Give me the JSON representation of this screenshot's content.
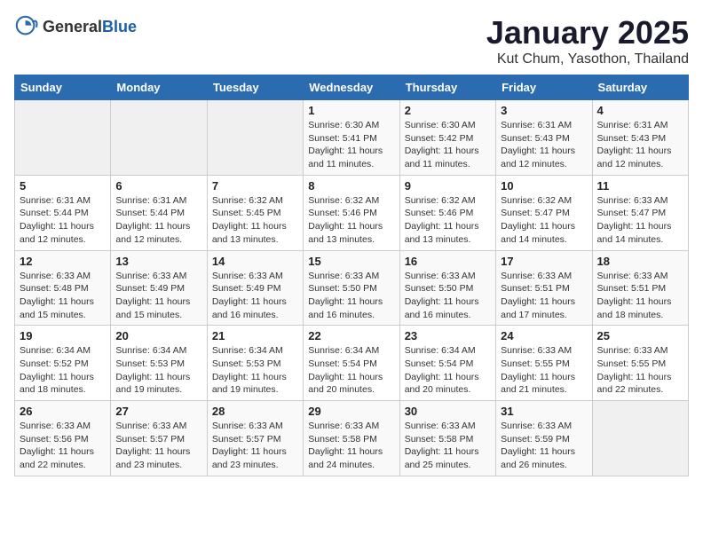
{
  "header": {
    "logo_general": "General",
    "logo_blue": "Blue",
    "title": "January 2025",
    "subtitle": "Kut Chum, Yasothon, Thailand"
  },
  "days_of_week": [
    "Sunday",
    "Monday",
    "Tuesday",
    "Wednesday",
    "Thursday",
    "Friday",
    "Saturday"
  ],
  "weeks": [
    [
      {
        "day": "",
        "info": ""
      },
      {
        "day": "",
        "info": ""
      },
      {
        "day": "",
        "info": ""
      },
      {
        "day": "1",
        "info": "Sunrise: 6:30 AM\nSunset: 5:41 PM\nDaylight: 11 hours\nand 11 minutes."
      },
      {
        "day": "2",
        "info": "Sunrise: 6:30 AM\nSunset: 5:42 PM\nDaylight: 11 hours\nand 11 minutes."
      },
      {
        "day": "3",
        "info": "Sunrise: 6:31 AM\nSunset: 5:43 PM\nDaylight: 11 hours\nand 12 minutes."
      },
      {
        "day": "4",
        "info": "Sunrise: 6:31 AM\nSunset: 5:43 PM\nDaylight: 11 hours\nand 12 minutes."
      }
    ],
    [
      {
        "day": "5",
        "info": "Sunrise: 6:31 AM\nSunset: 5:44 PM\nDaylight: 11 hours\nand 12 minutes."
      },
      {
        "day": "6",
        "info": "Sunrise: 6:31 AM\nSunset: 5:44 PM\nDaylight: 11 hours\nand 12 minutes."
      },
      {
        "day": "7",
        "info": "Sunrise: 6:32 AM\nSunset: 5:45 PM\nDaylight: 11 hours\nand 13 minutes."
      },
      {
        "day": "8",
        "info": "Sunrise: 6:32 AM\nSunset: 5:46 PM\nDaylight: 11 hours\nand 13 minutes."
      },
      {
        "day": "9",
        "info": "Sunrise: 6:32 AM\nSunset: 5:46 PM\nDaylight: 11 hours\nand 13 minutes."
      },
      {
        "day": "10",
        "info": "Sunrise: 6:32 AM\nSunset: 5:47 PM\nDaylight: 11 hours\nand 14 minutes."
      },
      {
        "day": "11",
        "info": "Sunrise: 6:33 AM\nSunset: 5:47 PM\nDaylight: 11 hours\nand 14 minutes."
      }
    ],
    [
      {
        "day": "12",
        "info": "Sunrise: 6:33 AM\nSunset: 5:48 PM\nDaylight: 11 hours\nand 15 minutes."
      },
      {
        "day": "13",
        "info": "Sunrise: 6:33 AM\nSunset: 5:49 PM\nDaylight: 11 hours\nand 15 minutes."
      },
      {
        "day": "14",
        "info": "Sunrise: 6:33 AM\nSunset: 5:49 PM\nDaylight: 11 hours\nand 16 minutes."
      },
      {
        "day": "15",
        "info": "Sunrise: 6:33 AM\nSunset: 5:50 PM\nDaylight: 11 hours\nand 16 minutes."
      },
      {
        "day": "16",
        "info": "Sunrise: 6:33 AM\nSunset: 5:50 PM\nDaylight: 11 hours\nand 16 minutes."
      },
      {
        "day": "17",
        "info": "Sunrise: 6:33 AM\nSunset: 5:51 PM\nDaylight: 11 hours\nand 17 minutes."
      },
      {
        "day": "18",
        "info": "Sunrise: 6:33 AM\nSunset: 5:51 PM\nDaylight: 11 hours\nand 18 minutes."
      }
    ],
    [
      {
        "day": "19",
        "info": "Sunrise: 6:34 AM\nSunset: 5:52 PM\nDaylight: 11 hours\nand 18 minutes."
      },
      {
        "day": "20",
        "info": "Sunrise: 6:34 AM\nSunset: 5:53 PM\nDaylight: 11 hours\nand 19 minutes."
      },
      {
        "day": "21",
        "info": "Sunrise: 6:34 AM\nSunset: 5:53 PM\nDaylight: 11 hours\nand 19 minutes."
      },
      {
        "day": "22",
        "info": "Sunrise: 6:34 AM\nSunset: 5:54 PM\nDaylight: 11 hours\nand 20 minutes."
      },
      {
        "day": "23",
        "info": "Sunrise: 6:34 AM\nSunset: 5:54 PM\nDaylight: 11 hours\nand 20 minutes."
      },
      {
        "day": "24",
        "info": "Sunrise: 6:33 AM\nSunset: 5:55 PM\nDaylight: 11 hours\nand 21 minutes."
      },
      {
        "day": "25",
        "info": "Sunrise: 6:33 AM\nSunset: 5:55 PM\nDaylight: 11 hours\nand 22 minutes."
      }
    ],
    [
      {
        "day": "26",
        "info": "Sunrise: 6:33 AM\nSunset: 5:56 PM\nDaylight: 11 hours\nand 22 minutes."
      },
      {
        "day": "27",
        "info": "Sunrise: 6:33 AM\nSunset: 5:57 PM\nDaylight: 11 hours\nand 23 minutes."
      },
      {
        "day": "28",
        "info": "Sunrise: 6:33 AM\nSunset: 5:57 PM\nDaylight: 11 hours\nand 23 minutes."
      },
      {
        "day": "29",
        "info": "Sunrise: 6:33 AM\nSunset: 5:58 PM\nDaylight: 11 hours\nand 24 minutes."
      },
      {
        "day": "30",
        "info": "Sunrise: 6:33 AM\nSunset: 5:58 PM\nDaylight: 11 hours\nand 25 minutes."
      },
      {
        "day": "31",
        "info": "Sunrise: 6:33 AM\nSunset: 5:59 PM\nDaylight: 11 hours\nand 26 minutes."
      },
      {
        "day": "",
        "info": ""
      }
    ]
  ]
}
